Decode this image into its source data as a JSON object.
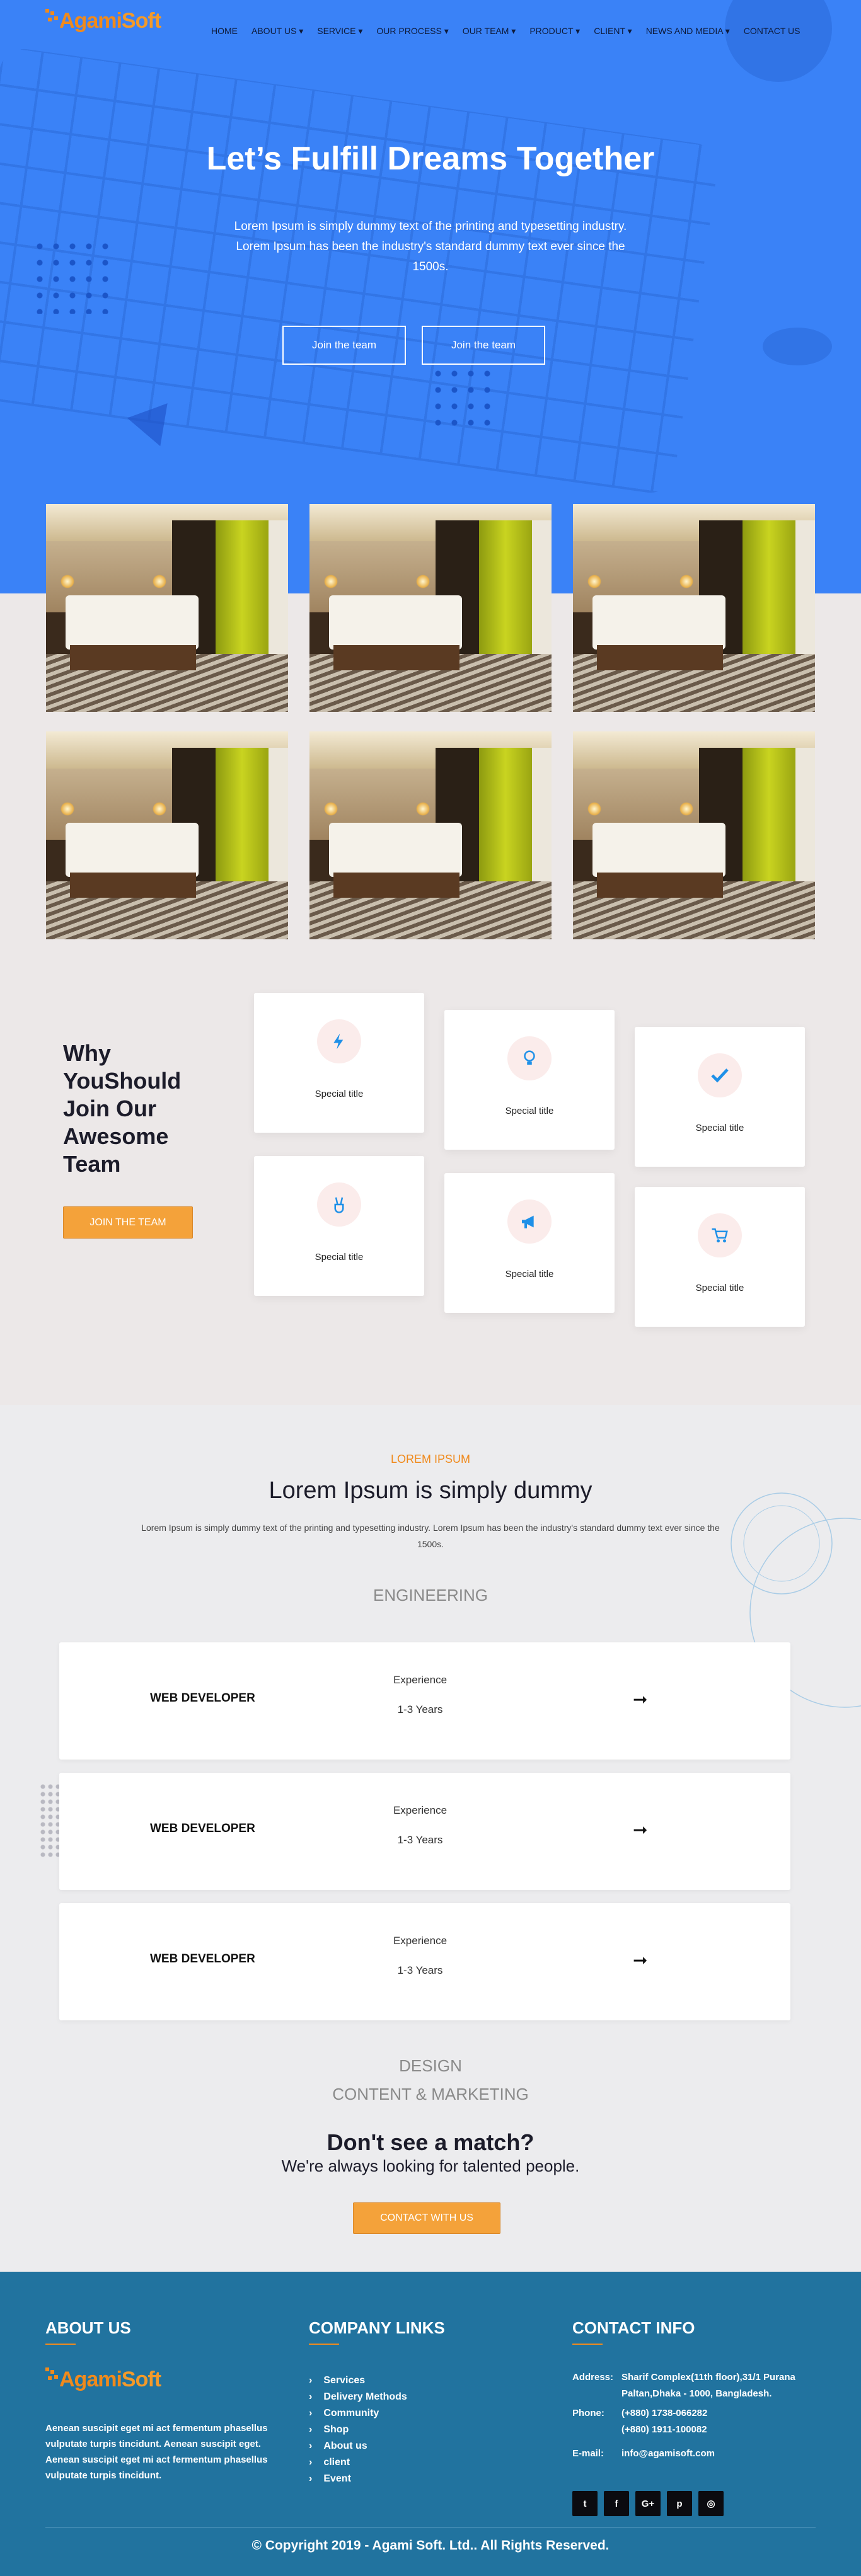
{
  "brand": {
    "agami": "Agami",
    "soft": "Soft"
  },
  "nav": [
    {
      "label": "HOME"
    },
    {
      "label": "ABOUT US"
    },
    {
      "label": "SERVICE"
    },
    {
      "label": "OUR PROCESS"
    },
    {
      "label": "OUR TEAM"
    },
    {
      "label": "PRODUCT"
    },
    {
      "label": "CLIENT"
    },
    {
      "label": "NEWS AND MEDIA"
    },
    {
      "label": "CONTACT US"
    }
  ],
  "hero": {
    "title": "Let’s Fulfill Dreams Together",
    "text": "Lorem Ipsum is simply dummy text of the printing and typesetting industry. Lorem Ipsum has been the industry's standard dummy text ever since the 1500s.",
    "btn1": "Join the team",
    "btn2": "Join the team"
  },
  "why": {
    "title": "Why YouShould Join Our Awesome Team",
    "button": "JOIN THE TEAM",
    "cards": [
      {
        "title": "Special title",
        "icon": "lightning-icon"
      },
      {
        "title": "Special title",
        "icon": "lightbulb-icon"
      },
      {
        "title": "Special title",
        "icon": "checkmark-icon"
      },
      {
        "title": "Special title",
        "icon": "peace-hand-icon"
      },
      {
        "title": "Special title",
        "icon": "megaphone-icon"
      },
      {
        "title": "Special title",
        "icon": "cart-icon"
      }
    ]
  },
  "careers": {
    "kicker": "LOREM IPSUM",
    "title": "Lorem Ipsum is simply dummy",
    "text": "Lorem Ipsum is simply dummy text of the printing and typesetting industry. Lorem Ipsum has been the industry's standard dummy text ever since the 1500s.",
    "category_engineering": "ENGINEERING",
    "jobs": [
      {
        "title": "WEB DEVELOPER",
        "exp_label": "Experience",
        "years": "1-3 Years"
      },
      {
        "title": "WEB DEVELOPER",
        "exp_label": "Experience",
        "years": "1-3 Years"
      },
      {
        "title": "WEB DEVELOPER",
        "exp_label": "Experience",
        "years": "1-3 Years"
      }
    ],
    "category_design": "DESIGN",
    "category_content": "CONTENT & MARKETING",
    "nomatch_title": "Don't see a match?",
    "nomatch_sub": "We're always looking for talented people.",
    "contact_button": "CONTACT WITH US"
  },
  "footer": {
    "about_title": "ABOUT US",
    "about_text": "Aenean suscipit eget mi act fermentum phasellus vulputate turpis tincidunt. Aenean suscipit eget. Aenean suscipit eget mi act fermentum phasellus vulputate turpis tincidunt.",
    "links_title": "COMPANY LINKS",
    "links": [
      {
        "label": "Services"
      },
      {
        "label": "Delivery Methods"
      },
      {
        "label": "Community"
      },
      {
        "label": "Shop"
      },
      {
        "label": "About us"
      },
      {
        "label": "client"
      },
      {
        "label": "Event"
      }
    ],
    "contact_title": "CONTACT INFO",
    "address_label": "Address:",
    "address": "Sharif Complex(11th floor),31/1 Purana Paltan,Dhaka - 1000, Bangladesh.",
    "phone_label": "Phone:",
    "phone1": "(+880) 1738-066282",
    "phone2": "(+880) 1911-100082",
    "email_label": "E-mail:",
    "email": "info@agamisoft.com",
    "social": [
      {
        "icon": "twitter-icon",
        "glyph": "t"
      },
      {
        "icon": "facebook-icon",
        "glyph": "f"
      },
      {
        "icon": "google-plus-icon",
        "glyph": "G+"
      },
      {
        "icon": "pinterest-icon",
        "glyph": "p"
      },
      {
        "icon": "dribbble-icon",
        "glyph": "◎"
      }
    ],
    "copyright": "© Copyright 2019 - Agami Soft. Ltd.. All Rights Reserved."
  }
}
